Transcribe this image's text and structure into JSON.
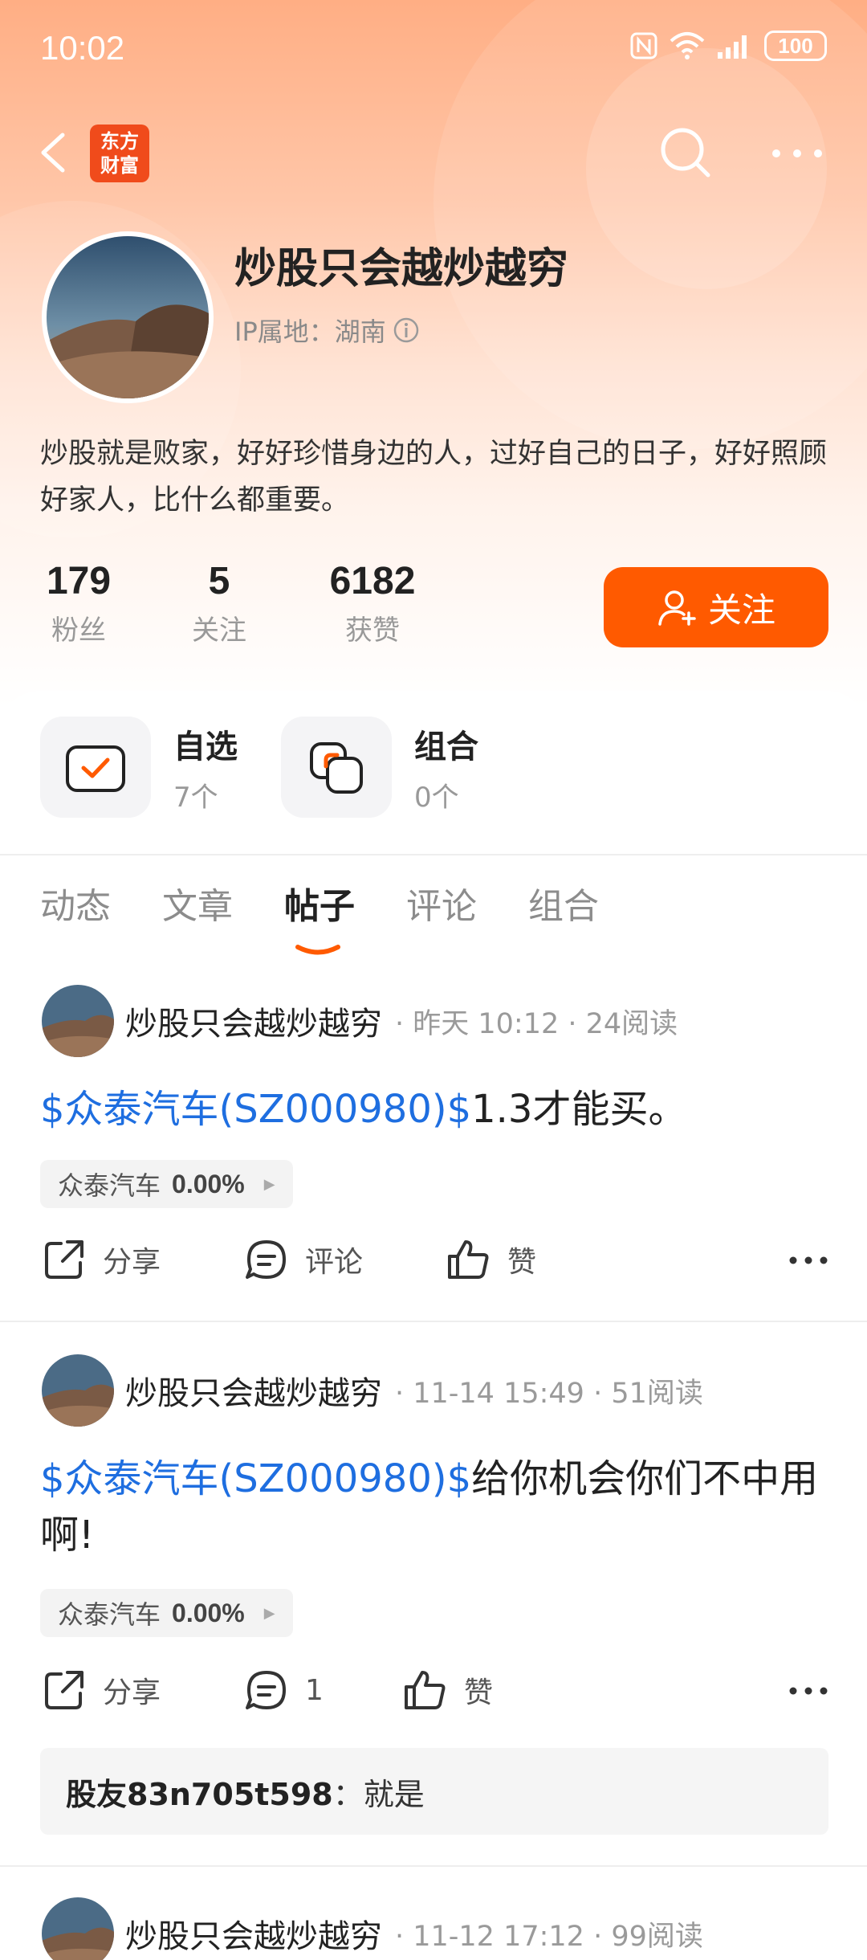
{
  "status_bar": {
    "time": "10:02",
    "battery": "100"
  },
  "nav": {
    "logo_line1": "东方",
    "logo_line2": "财富"
  },
  "profile": {
    "name": "炒股只会越炒越穷",
    "ip_label": "IP属地：湖南",
    "bio": "炒股就是败家，好好珍惜身边的人，过好自己的日子，好好照顾好家人，比什么都重要。",
    "stats": [
      {
        "value": "179",
        "label": "粉丝"
      },
      {
        "value": "5",
        "label": "关注"
      },
      {
        "value": "6182",
        "label": "获赞"
      }
    ],
    "follow_label": "关注"
  },
  "shortcuts": [
    {
      "title": "自选",
      "count": "7个",
      "icon": "checkbox-icon"
    },
    {
      "title": "组合",
      "count": "0个",
      "icon": "portfolio-icon"
    }
  ],
  "tabs": [
    {
      "label": "动态",
      "active": false
    },
    {
      "label": "文章",
      "active": false
    },
    {
      "label": "帖子",
      "active": true
    },
    {
      "label": "评论",
      "active": false
    },
    {
      "label": "组合",
      "active": false
    }
  ],
  "posts": [
    {
      "author": "炒股只会越炒越穷",
      "meta": "· 昨天 10:12 · 24阅读",
      "stock_link": "$众泰汽车(SZ000980)$",
      "text": "1.3才能买。",
      "tag_name": "众泰汽车",
      "tag_value": "0.00%",
      "share_label": "分享",
      "comment_label": "评论",
      "like_label": "赞"
    },
    {
      "author": "炒股只会越炒越穷",
      "meta": "· 11-14 15:49 · 51阅读",
      "stock_link": "$众泰汽车(SZ000980)$",
      "text": "给你机会你们不中用啊!",
      "tag_name": "众泰汽车",
      "tag_value": "0.00%",
      "share_label": "分享",
      "comment_label": "1",
      "like_label": "赞",
      "comment_user": "股友83n705t598",
      "comment_text": "：就是"
    },
    {
      "author": "炒股只会越炒越穷",
      "meta": "· 11-12 17:12 · 99阅读"
    }
  ],
  "colors": {
    "accent": "#ff5a00",
    "link": "#1e6ee0",
    "brand_logo": "#f04b1b"
  }
}
